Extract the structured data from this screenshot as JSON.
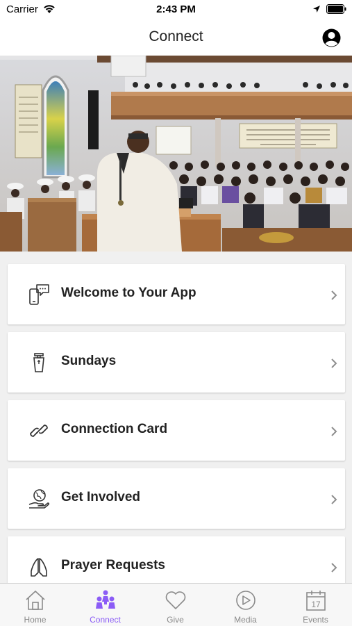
{
  "status_bar": {
    "carrier": "Carrier",
    "time": "2:43 PM",
    "icons": [
      "wifi-icon",
      "location-arrow-icon",
      "battery-icon"
    ]
  },
  "nav": {
    "title": "Connect",
    "profile_icon": "user-circle-icon"
  },
  "hero": {
    "image": "church-congregation-photo",
    "banner_left": "Follow me...",
    "banner_right": "And the Word became Flesh and dwelt among us..."
  },
  "menu": {
    "items": [
      {
        "label": "Welcome to Your App",
        "icon": "phone-chat-icon"
      },
      {
        "label": "Sundays",
        "icon": "pulpit-icon"
      },
      {
        "label": "Connection Card",
        "icon": "link-icon"
      },
      {
        "label": "Get Involved",
        "icon": "globe-hand-icon"
      },
      {
        "label": "Prayer Requests",
        "icon": "praying-hands-icon"
      }
    ]
  },
  "tabs": [
    {
      "label": "Home",
      "icon": "house-icon",
      "active": false
    },
    {
      "label": "Connect",
      "icon": "people-icon",
      "active": true
    },
    {
      "label": "Give",
      "icon": "heart-icon",
      "active": false
    },
    {
      "label": "Media",
      "icon": "play-circle-icon",
      "active": false
    },
    {
      "label": "Events",
      "icon": "calendar-icon",
      "active": false,
      "calendar_day": "17"
    }
  ],
  "colors": {
    "accent": "#8b5cf6",
    "inactive": "#8a8a8a",
    "card_bg": "#ffffff",
    "page_bg": "#f0f0f0"
  }
}
